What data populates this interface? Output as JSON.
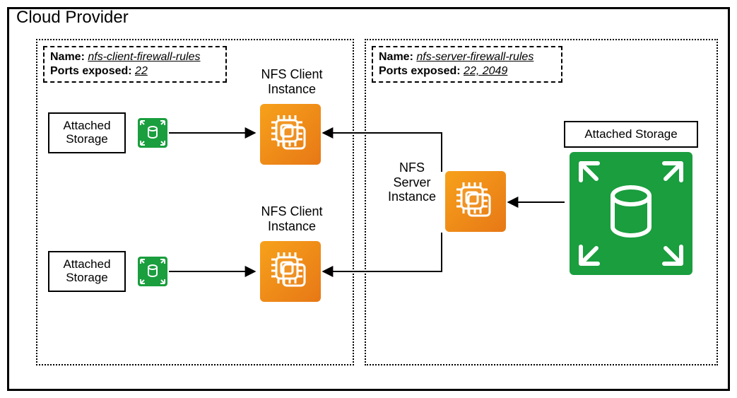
{
  "diagram": {
    "title": "Cloud Provider",
    "client_group": {
      "fw_name_label": "Name:",
      "fw_name_value": "nfs-client-firewall-rules",
      "fw_ports_label": "Ports exposed:",
      "fw_ports_value": "22",
      "client1_label": "NFS Client Instance",
      "client2_label": "NFS Client Instance",
      "storage1_label": "Attached Storage",
      "storage2_label": "Attached Storage"
    },
    "server_group": {
      "fw_name_label": "Name:",
      "fw_name_value": "nfs-server-firewall-rules",
      "fw_ports_label": "Ports exposed:",
      "fw_ports_value": "22, 2049",
      "server_label": "NFS Server Instance",
      "storage_label": "Attached Storage"
    }
  }
}
